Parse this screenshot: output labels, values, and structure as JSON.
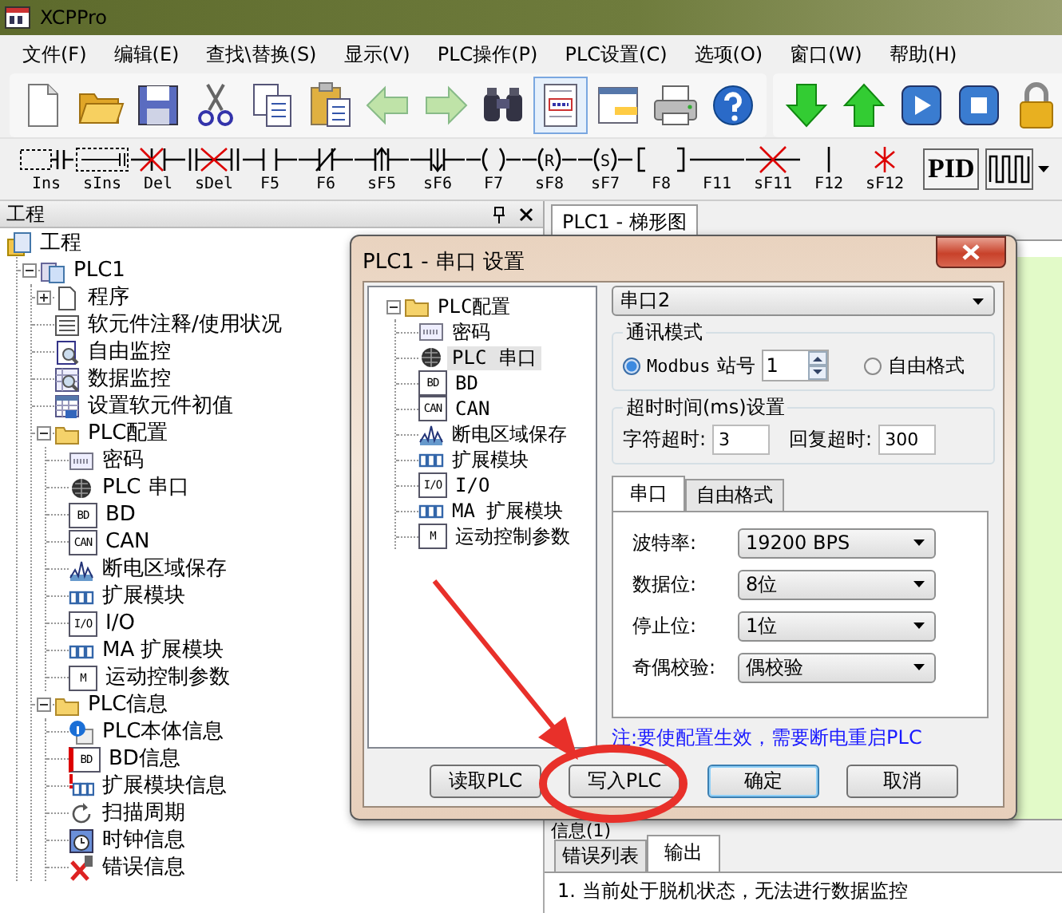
{
  "window": {
    "title": "XCPPro"
  },
  "menu": [
    "文件(F)",
    "编辑(E)",
    "查找\\替换(S)",
    "显示(V)",
    "PLC操作(P)",
    "PLC设置(C)",
    "选项(O)",
    "窗口(W)",
    "帮助(H)"
  ],
  "toolbar": {
    "groups": [
      [
        {
          "kind": "new",
          "selected": false
        },
        {
          "kind": "open",
          "selected": false
        },
        {
          "kind": "save",
          "selected": false
        },
        {
          "kind": "cut",
          "selected": false
        },
        {
          "kind": "copy",
          "selected": false
        },
        {
          "kind": "paste",
          "selected": false
        },
        {
          "kind": "back",
          "selected": false
        },
        {
          "kind": "forward",
          "selected": false
        },
        {
          "kind": "find",
          "selected": false
        },
        {
          "kind": "docview",
          "selected": true
        },
        {
          "kind": "window",
          "selected": false
        },
        {
          "kind": "print",
          "selected": false
        },
        {
          "kind": "help",
          "selected": false
        }
      ],
      [
        {
          "kind": "download",
          "selected": false
        },
        {
          "kind": "upload",
          "selected": false
        },
        {
          "kind": "run",
          "selected": false
        },
        {
          "kind": "stop",
          "selected": false
        },
        {
          "kind": "lock",
          "selected": false
        }
      ]
    ]
  },
  "ladder_toolbar": [
    {
      "kind": "insert",
      "label": "Ins"
    },
    {
      "kind": "insert-row",
      "label": "sIns"
    },
    {
      "kind": "delete",
      "label": "Del"
    },
    {
      "kind": "delete-row",
      "label": "sDel"
    },
    {
      "kind": "contact",
      "label": "F5"
    },
    {
      "kind": "nc-contact",
      "label": "F6"
    },
    {
      "kind": "rise",
      "label": "sF5"
    },
    {
      "kind": "fall",
      "label": "sF6"
    },
    {
      "kind": "coil",
      "label": "F7"
    },
    {
      "kind": "coil",
      "label": "sF8",
      "icon_text": "R"
    },
    {
      "kind": "coil",
      "label": "sF7",
      "icon_text": "S"
    },
    {
      "kind": "instruction",
      "label": "F8"
    },
    {
      "kind": "hline",
      "label": "F11"
    },
    {
      "kind": "del-hline",
      "label": "sF11"
    },
    {
      "kind": "vline",
      "label": "F12"
    },
    {
      "kind": "del-vline",
      "label": "sF12"
    },
    {
      "kind": "pid",
      "label": "PID"
    },
    {
      "kind": "pulse"
    },
    {
      "kind": "more"
    }
  ],
  "project_panel": {
    "title": "工程",
    "tree": [
      {
        "label": "工程",
        "kind": "project",
        "children": [
          {
            "label": "PLC1",
            "kind": "plc",
            "expanded": true,
            "children": [
              {
                "label": "程序",
                "kind": "page",
                "expanded": false
              },
              {
                "label": "软元件注释/使用状况",
                "kind": "list"
              },
              {
                "label": "自由监控",
                "kind": "monitor"
              },
              {
                "label": "数据监控",
                "kind": "data-monitor"
              },
              {
                "label": "设置软元件初值",
                "kind": "init"
              },
              {
                "label": "PLC配置",
                "kind": "folder",
                "expanded": true,
                "children": [
                  {
                    "label": "密码",
                    "kind": "password"
                  },
                  {
                    "label": "PLC 串口",
                    "kind": "port"
                  },
                  {
                    "label": "BD",
                    "kind": "letter",
                    "icon_text": "BD"
                  },
                  {
                    "label": "CAN",
                    "kind": "letter",
                    "icon_text": "CAN"
                  },
                  {
                    "label": "断电区域保存",
                    "kind": "wave"
                  },
                  {
                    "label": "扩展模块",
                    "kind": "modules"
                  },
                  {
                    "label": "I/O",
                    "kind": "letter",
                    "icon_text": "I/O"
                  },
                  {
                    "label": "MA 扩展模块",
                    "kind": "modules"
                  },
                  {
                    "label": "运动控制参数",
                    "kind": "letter",
                    "icon_text": "M"
                  }
                ]
              },
              {
                "label": "PLC信息",
                "kind": "folder",
                "expanded": true,
                "children": [
                  {
                    "label": "PLC本体信息",
                    "kind": "info"
                  },
                  {
                    "label": "BD信息",
                    "kind": "letter-alert",
                    "icon_text": "BD"
                  },
                  {
                    "label": "扩展模块信息",
                    "kind": "modules-alert"
                  },
                  {
                    "label": "扫描周期",
                    "kind": "scan"
                  },
                  {
                    "label": "时钟信息",
                    "kind": "clock"
                  },
                  {
                    "label": "错误信息",
                    "kind": "error"
                  }
                ]
              }
            ]
          }
        ]
      }
    ]
  },
  "editor": {
    "tab": "PLC1 - 梯形图"
  },
  "info_panel": {
    "title": "信息(1)",
    "tabs": [
      {
        "label": "错误列表",
        "selected": false
      },
      {
        "label": "输出",
        "selected": true
      }
    ],
    "messages": [
      "1. 当前处于脱机状态，无法进行数据监控"
    ]
  },
  "dialog": {
    "title": "PLC1 - 串口 设置",
    "tree": [
      {
        "label": "PLC配置",
        "kind": "folder",
        "expanded": true,
        "selected": false,
        "children": [
          {
            "label": "密码",
            "kind": "password",
            "selected": false
          },
          {
            "label": "PLC 串口",
            "kind": "port",
            "selected": true
          },
          {
            "label": "BD",
            "kind": "letter",
            "icon_text": "BD",
            "selected": false
          },
          {
            "label": "CAN",
            "kind": "letter",
            "icon_text": "CAN",
            "selected": false
          },
          {
            "label": "断电区域保存",
            "kind": "wave",
            "selected": false
          },
          {
            "label": "扩展模块",
            "kind": "modules",
            "selected": false
          },
          {
            "label": "I/O",
            "kind": "letter",
            "icon_text": "I/O",
            "selected": false
          },
          {
            "label": "MA 扩展模块",
            "kind": "modules",
            "selected": false
          },
          {
            "label": "运动控制参数",
            "kind": "letter",
            "icon_text": "M",
            "selected": false
          }
        ]
      }
    ],
    "port": {
      "value": "串口2"
    },
    "comm_mode": {
      "title": "通讯模式",
      "options": [
        {
          "label": "Modbus",
          "selected": true
        },
        {
          "label": "自由格式",
          "selected": false
        }
      ],
      "station_label": "站号",
      "station": "1"
    },
    "timeout": {
      "title": "超时时间(ms)设置",
      "fields": [
        {
          "label": "字符超时:",
          "value": "3"
        },
        {
          "label": "回复超时:",
          "value": "300"
        }
      ]
    },
    "tabs": [
      {
        "label": "串口",
        "selected": true
      },
      {
        "label": "自由格式",
        "selected": false
      }
    ],
    "settings": [
      {
        "label": "波特率:",
        "value": "19200 BPS"
      },
      {
        "label": "数据位:",
        "value": "8位"
      },
      {
        "label": "停止位:",
        "value": "1位"
      },
      {
        "label": "奇偶校验:",
        "value": "偶校验"
      }
    ],
    "note": "注:要使配置生效，需要断电重启PLC",
    "buttons": [
      {
        "label": "读取PLC",
        "default": false
      },
      {
        "label": "写入PLC",
        "default": false
      },
      {
        "label": "确定",
        "default": true
      },
      {
        "label": "取消",
        "default": false
      }
    ]
  },
  "annotations": {
    "arrow": true,
    "ellipse": true
  }
}
